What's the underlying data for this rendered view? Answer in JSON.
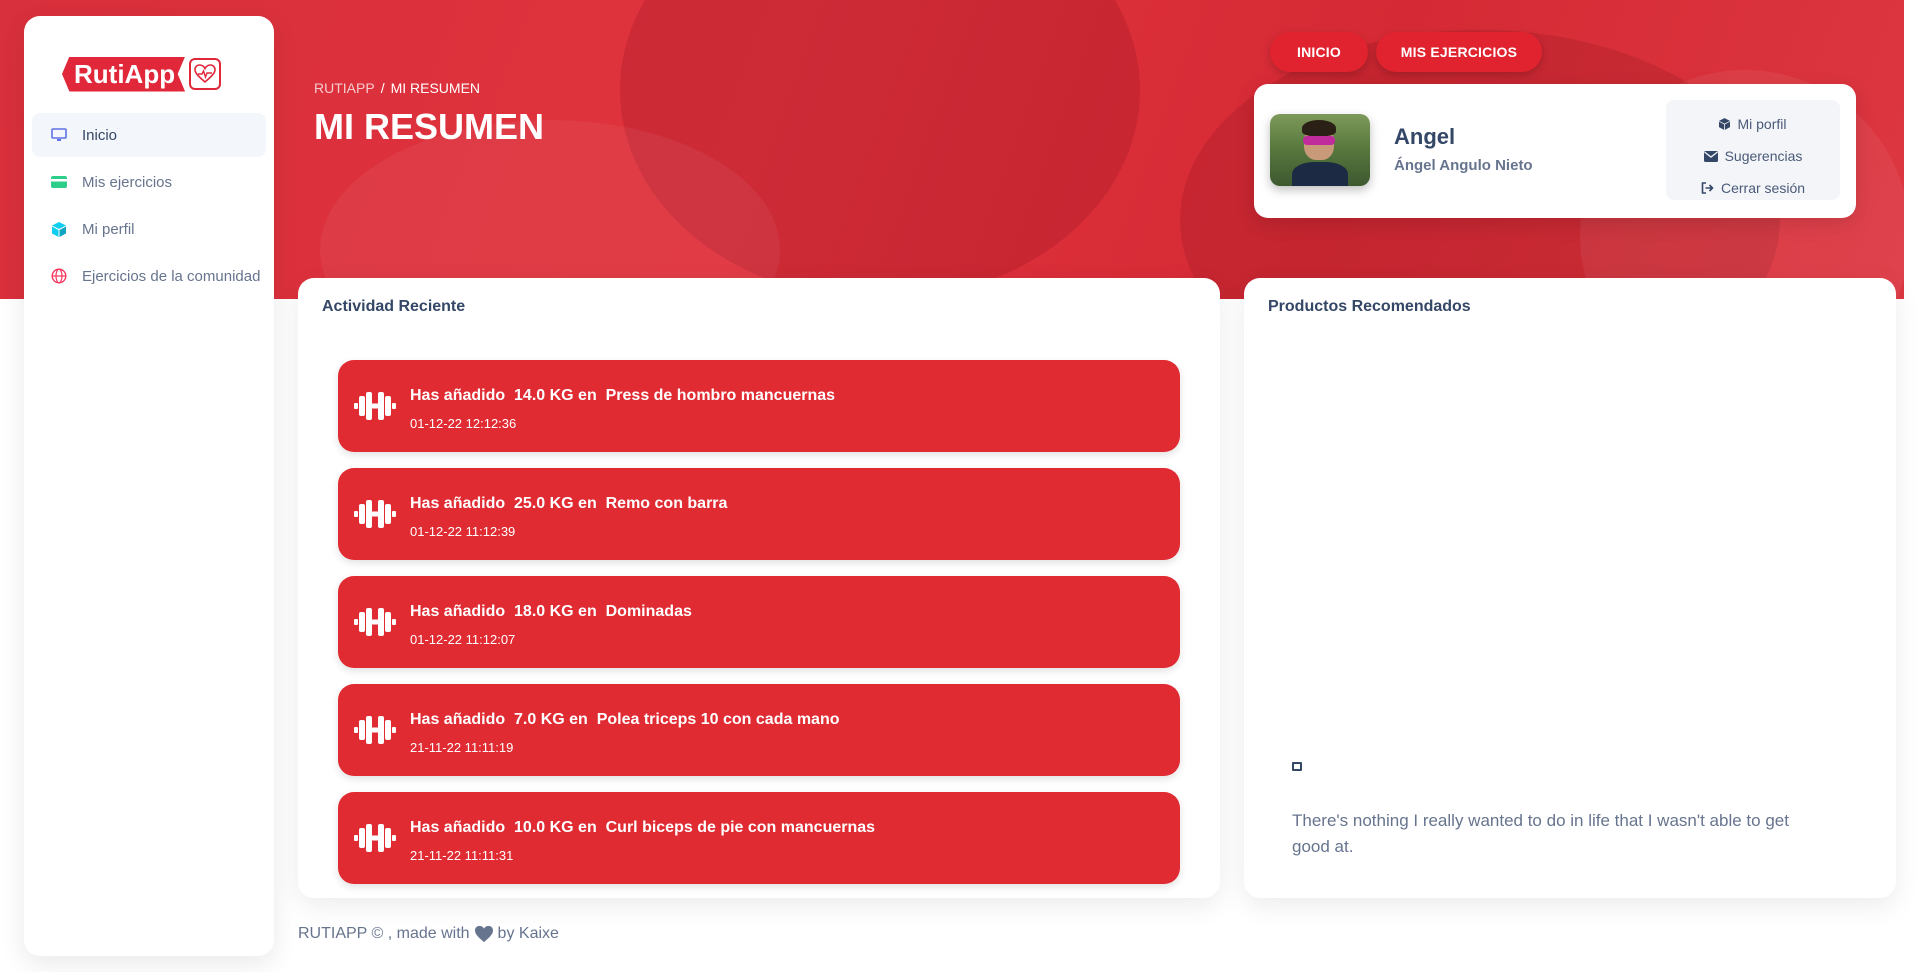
{
  "app": {
    "logo_text": "RutiApp"
  },
  "sidebar": {
    "items": [
      {
        "label": "Inicio",
        "icon": "monitor-icon",
        "active": true
      },
      {
        "label": "Mis ejercicios",
        "icon": "credit-card-icon"
      },
      {
        "label": "Mi perfil",
        "icon": "cube-icon"
      },
      {
        "label": "Ejercicios de la comunidad",
        "icon": "globe-icon"
      }
    ]
  },
  "header": {
    "breadcrumb": {
      "root": "RUTIAPP",
      "separator": "/",
      "current": "MI RESUMEN"
    },
    "title": "MI RESUMEN",
    "nav_buttons": {
      "inicio": "INICIO",
      "mis_ejercicios": "MIS EJERCICIOS"
    }
  },
  "user_card": {
    "name": "Angel",
    "full_name": "Ángel Angulo Nieto",
    "menu": {
      "profile": "Mi porfil",
      "suggestions": "Sugerencias",
      "logout": "Cerrar sesión"
    }
  },
  "activity": {
    "title": "Actividad Reciente",
    "items": [
      {
        "text": "Has añadido  14.0 KG en  Press de hombro mancuernas",
        "date": "01-12-22 12:12:36"
      },
      {
        "text": "Has añadido  25.0 KG en  Remo con barra",
        "date": "01-12-22 11:12:39"
      },
      {
        "text": "Has añadido  18.0 KG en  Dominadas",
        "date": "01-12-22 11:12:07"
      },
      {
        "text": "Has añadido  7.0 KG en  Polea triceps 10 con cada mano",
        "date": "21-11-22 11:11:19"
      },
      {
        "text": "Has añadido  10.0 KG en  Curl biceps de pie con mancuernas",
        "date": "21-11-22 11:11:31"
      }
    ]
  },
  "products": {
    "title": "Productos Recomendados",
    "quote": "There's nothing I really wanted to do in life that I wasn't able to get good at."
  },
  "footer": {
    "left": "RUTIAPP © , made with",
    "right": "by Kaixe"
  },
  "colors": {
    "brand_red": "#e0283a",
    "card_red": "#e02b33",
    "text_dark": "#344767",
    "text_muted": "#67748e"
  }
}
